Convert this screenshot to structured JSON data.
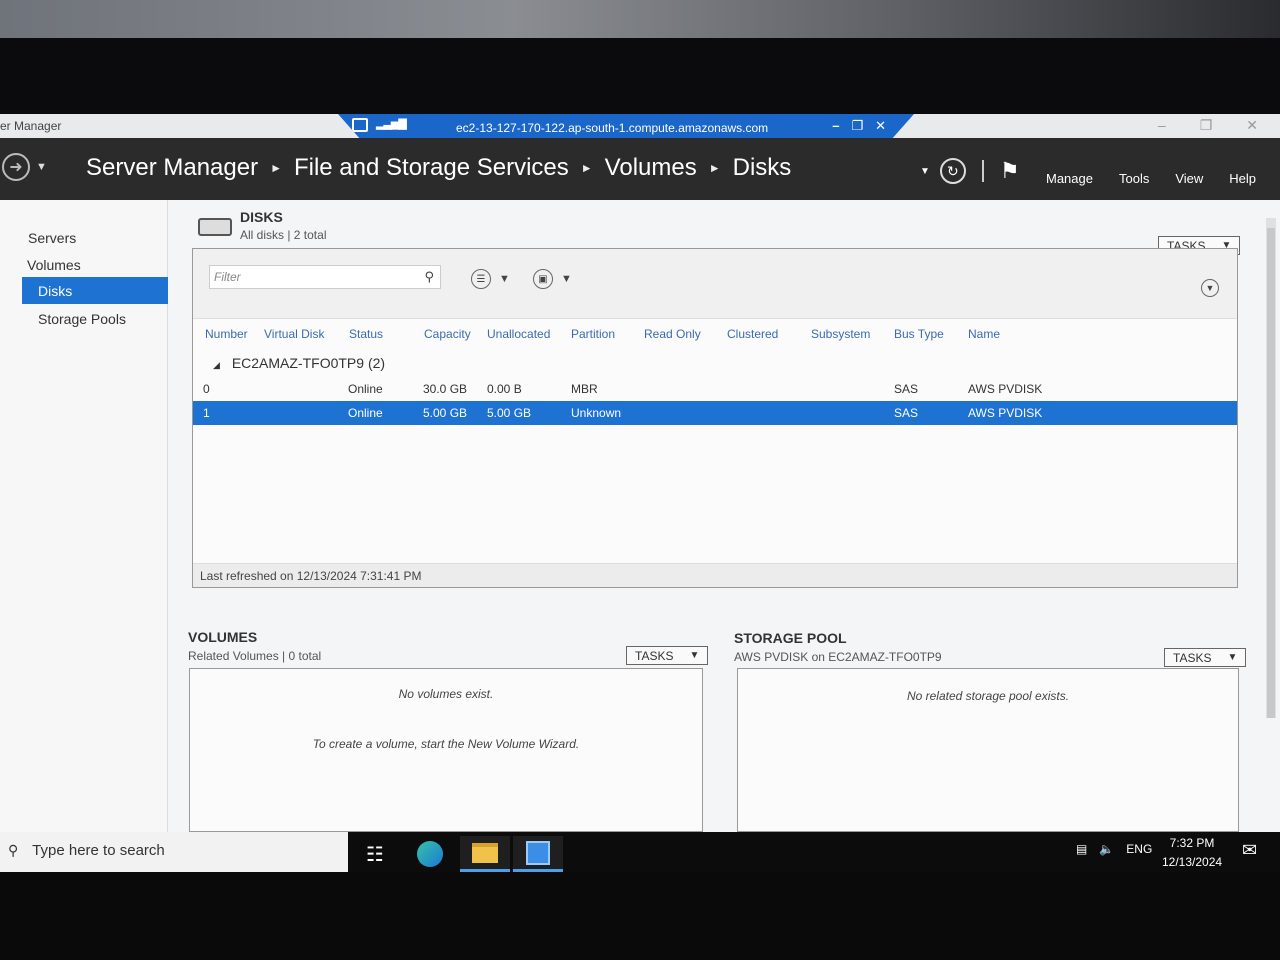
{
  "window": {
    "app_title": "er Manager",
    "rdp_host": "ec2-13-127-170-122.ap-south-1.compute.amazonaws.com"
  },
  "header": {
    "breadcrumb": [
      "Server Manager",
      "File and Storage Services",
      "Volumes",
      "Disks"
    ],
    "menu": [
      "Manage",
      "Tools",
      "View",
      "Help"
    ]
  },
  "sidebar": {
    "items": [
      {
        "label": "Servers"
      },
      {
        "label": "Volumes"
      },
      {
        "label": "Disks",
        "active": true
      },
      {
        "label": "Storage Pools"
      }
    ]
  },
  "disks": {
    "title": "DISKS",
    "subtitle": "All disks | 2 total",
    "tasks_label": "TASKS",
    "filter_placeholder": "Filter",
    "columns": [
      "Number",
      "Virtual Disk",
      "Status",
      "Capacity",
      "Unallocated",
      "Partition",
      "Read Only",
      "Clustered",
      "Subsystem",
      "Bus Type",
      "Name"
    ],
    "group": "EC2AMAZ-TFO0TP9 (2)",
    "rows": [
      {
        "number": "0",
        "virtual_disk": "",
        "status": "Online",
        "capacity": "30.0 GB",
        "unallocated": "0.00 B",
        "partition": "MBR",
        "bus_type": "SAS",
        "name": "AWS PVDISK"
      },
      {
        "number": "1",
        "virtual_disk": "",
        "status": "Online",
        "capacity": "5.00 GB",
        "unallocated": "5.00 GB",
        "partition": "Unknown",
        "bus_type": "SAS",
        "name": "AWS PVDISK",
        "selected": true
      }
    ],
    "footer": "Last refreshed on 12/13/2024 7:31:41 PM"
  },
  "volumes": {
    "title": "VOLUMES",
    "subtitle": "Related Volumes | 0 total",
    "tasks_label": "TASKS",
    "empty_message": "No volumes exist.",
    "hint": "To create a volume, start the New Volume Wizard."
  },
  "storage_pool": {
    "title": "STORAGE POOL",
    "subtitle": "AWS PVDISK on EC2AMAZ-TFO0TP9",
    "tasks_label": "TASKS",
    "empty_message": "No related storage pool exists."
  },
  "taskbar": {
    "search_placeholder": "Type here to search",
    "language": "ENG",
    "time": "7:32 PM",
    "date": "12/13/2024"
  },
  "colors": {
    "accent": "#1e72d1",
    "header_bg": "#2b2b2b",
    "rdp_bar": "#1b67c9"
  }
}
